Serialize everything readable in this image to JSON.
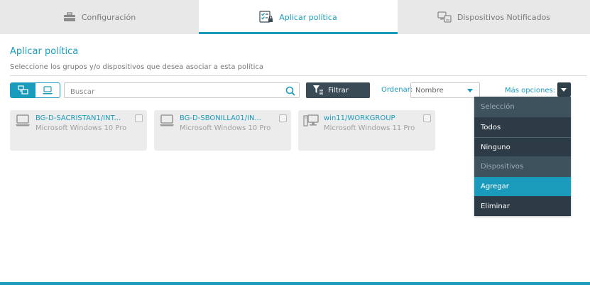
{
  "tabs": [
    {
      "label": "Configuración",
      "icon": "toolbox-icon"
    },
    {
      "label": "Aplicar política",
      "icon": "checklist-lock-icon",
      "active": true
    },
    {
      "label": "Dispositivos Notificados",
      "icon": "devices-icon"
    }
  ],
  "page": {
    "title": "Aplicar política",
    "subtitle": "Seleccione los grupos y/o dispositivos que desea asociar a esta política"
  },
  "toolbar": {
    "search_placeholder": "Buscar",
    "filter_label": "Filtrar",
    "sort_label": "Ordenar:",
    "sort_value": "Nombre",
    "more_label": "Más opciones:"
  },
  "devices": [
    {
      "name": "BG-D-SACRISTAN1/INT...",
      "os": "Microsoft Windows 10 Pro",
      "type": "laptop-icon",
      "checked": false
    },
    {
      "name": "BG-D-SBONILLA01/IN...",
      "os": "Microsoft Windows 10 Pro",
      "type": "laptop-icon",
      "checked": false
    },
    {
      "name": "win11/WORKGROUP",
      "os": "Microsoft Windows 11 Pro",
      "type": "desktop-icon",
      "checked": false
    }
  ],
  "menu": {
    "header_selection": "Selección",
    "all": "Todos",
    "none": "Ninguno",
    "header_devices": "Dispositivos",
    "add": "Agregar",
    "remove": "Eliminar"
  },
  "colors": {
    "accent": "#1a9bbb",
    "menu_dark": "#2c3b45",
    "filter_button": "#3a4b55"
  }
}
